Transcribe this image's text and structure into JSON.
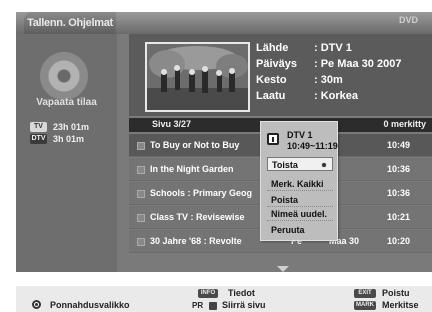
{
  "header": {
    "tab_label": "Tallenn. Ohjelmat",
    "brand": "DVD"
  },
  "sidebar": {
    "free_space_title": "Vapaata tilaa",
    "rows": [
      {
        "badge": "TV",
        "time": "23h 01m"
      },
      {
        "badge": "DTV",
        "time": "3h 01m"
      }
    ]
  },
  "info": {
    "fields": [
      {
        "label": "Lähde",
        "value": ": DTV 1"
      },
      {
        "label": "Päiväys",
        "value": ": Pe Maa 30 2007"
      },
      {
        "label": "Kesto",
        "value": ": 30m"
      },
      {
        "label": "Laatu",
        "value": ": Korkea"
      }
    ]
  },
  "list": {
    "page": "Sivu  3/27",
    "marked": "0 merkitty",
    "rows": [
      {
        "title": "To Buy or Not to Buy",
        "channel": "",
        "date": "",
        "time": "10:49"
      },
      {
        "title": "In the Night Garden",
        "channel": "",
        "date": "",
        "time": "10:36"
      },
      {
        "title": "Schools : Primary Geog",
        "channel": "",
        "date": "",
        "time": "10:36"
      },
      {
        "title": "Class TV : Revisewise",
        "channel": "",
        "date": "",
        "time": "10:21"
      },
      {
        "title": "30 Jahre '68 : Revolte",
        "channel": "Pe",
        "date": "Maa 30",
        "time": "10:20"
      }
    ]
  },
  "popup": {
    "channel": "DTV 1",
    "time_range": "10:49~11:19",
    "items": [
      "Toista",
      "Merk. Kaikki",
      "Poista",
      "Nimeä uudel.",
      "Peruuta"
    ]
  },
  "footer": {
    "popup_menu": "Ponnahdusvalikko",
    "info_key": "INFO",
    "info_label": "Tiedot",
    "pr_key": "PR",
    "pr_label": "Siirrä sivu",
    "exit_key": "EXIT",
    "exit_label": "Poistu",
    "mark_key": "MARK",
    "mark_label": "Merkitse"
  }
}
